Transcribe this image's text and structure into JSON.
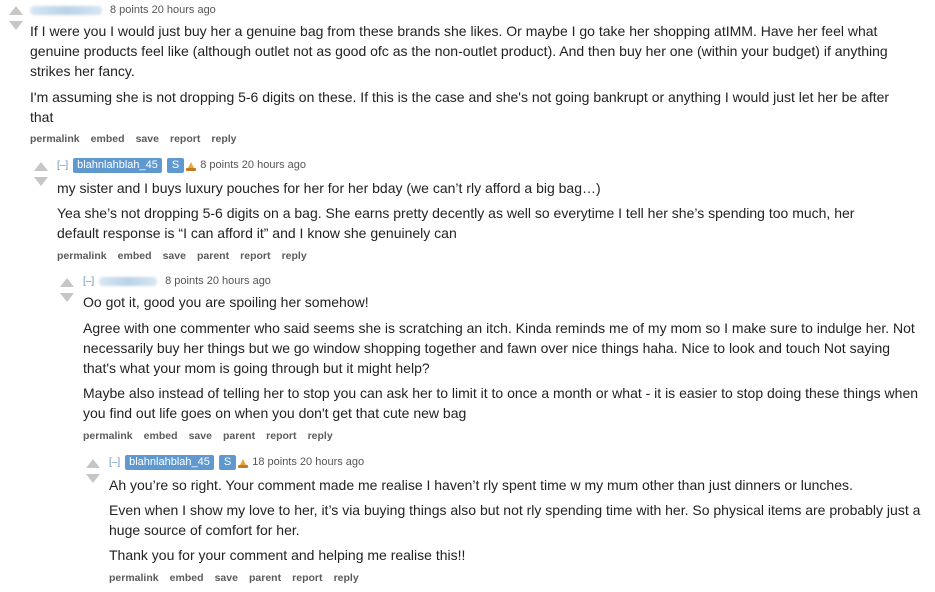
{
  "comments": [
    {
      "score_time": "8 points 20 hours ago",
      "paragraphs": [
        "If I were you I would just buy her a genuine bag from these brands she likes. Or maybe I go take her shopping atIMM. Have her feel what genuine products feel like (although outlet not as good ofc as the non-outlet product). And then buy her one (within your budget) if anything strikes her fancy.",
        "I'm assuming she is not dropping 5-6 digits on these. If this is the case and she's not going bankrupt or anything I would just let her be after that"
      ],
      "buttons": [
        "permalink",
        "embed",
        "save",
        "report",
        "reply"
      ]
    },
    {
      "collapse": "[–]",
      "author": "blahnlahblah_45",
      "badge": "S",
      "score_time": "8 points 20 hours ago",
      "paragraphs": [
        "my sister and I buys luxury pouches for her for her bday (we can’t rly afford a big bag…)",
        "Yea she’s not dropping 5-6 digits on a bag. She earns pretty decently as well so everytime I tell her she’s spending too much, her default response is “I can afford it” and I know she genuinely can"
      ],
      "buttons": [
        "permalink",
        "embed",
        "save",
        "parent",
        "report",
        "reply"
      ]
    },
    {
      "collapse": "[–]",
      "score_time": "8 points 20 hours ago",
      "paragraphs": [
        "Oo got it, good you are spoiling her somehow!",
        "Agree with one commenter who said seems she is scratching an itch. Kinda reminds me of my mom so I make sure to indulge her. Not necessarily buy her things but we go window shopping together and fawn over nice things haha. Nice to look and touch Not saying that's what your mom is going through but it might help?",
        "Maybe also instead of telling her to stop you can ask her to limit it to once a month or what - it is easier to stop doing these things when you find out life goes on when you don't get that cute new bag"
      ],
      "buttons": [
        "permalink",
        "embed",
        "save",
        "parent",
        "report",
        "reply"
      ]
    },
    {
      "collapse": "[–]",
      "author": "blahnlahblah_45",
      "badge": "S",
      "score_time": "18 points 20 hours ago",
      "paragraphs": [
        "Ah you’re so right. Your comment made me realise I haven’t rly spent time w my mum other than just dinners or lunches.",
        "Even when I show my love to her, it’s via buying things also but not rly spending time with her. So physical items are probably just a huge source of comfort for her.",
        "Thank you for your comment and helping me realise this!!"
      ],
      "buttons": [
        "permalink",
        "embed",
        "save",
        "parent",
        "report",
        "reply"
      ]
    }
  ],
  "colors": {
    "badge": "#5f99cf",
    "arrow": "#c6c6c6",
    "collapse": "#6a8fb5"
  },
  "icons": {
    "upvote": "upvote-arrow-icon",
    "downvote": "downvote-arrow-icon",
    "flair": "flair-icon"
  }
}
